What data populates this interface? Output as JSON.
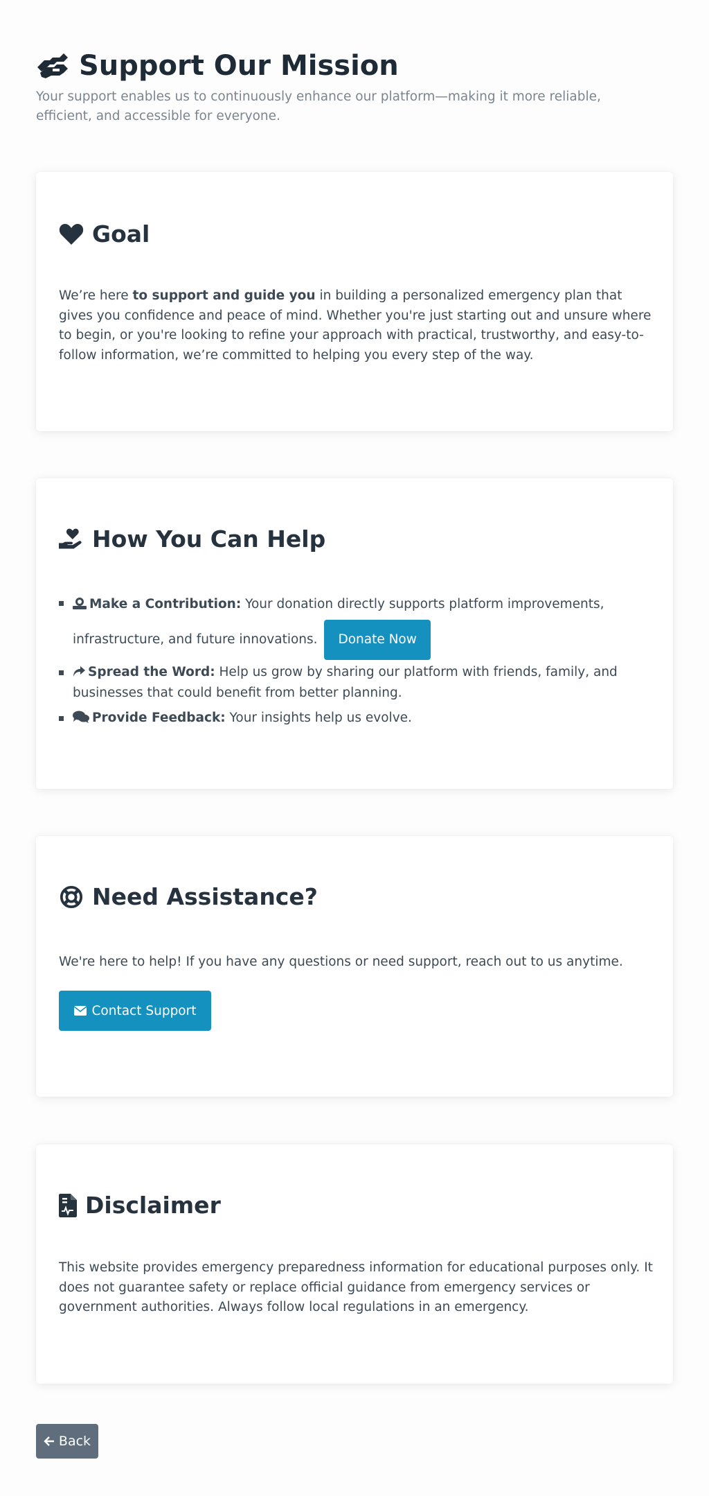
{
  "header": {
    "title": "Support Our Mission",
    "subtitle": "Your support enables us to continuously enhance our platform—making it more reliable, efficient, and accessible for everyone.",
    "icon": "handshake-icon"
  },
  "goal": {
    "title": "Goal",
    "icon": "heart-icon",
    "text_before": "We’re here ",
    "text_bold": "to support and guide you",
    "text_after": " in building a personalized emergency plan that gives you confidence and peace of mind. Whether you're just starting out and unsure where to begin, or you're looking to refine your approach with practical, trustworthy, and easy-to-follow information, we’re committed to helping you every step of the way."
  },
  "help": {
    "title": "How You Can Help",
    "icon": "hand-holding-heart-icon",
    "items": [
      {
        "label": "Make a Contribution:",
        "text_line1": " Your donation directly supports platform improvements,",
        "text_line2": "infrastructure, and future innovations.",
        "icon": "donate-icon",
        "button": "Donate Now"
      },
      {
        "label": "Spread the Word:",
        "text": " Help us grow by sharing our platform with friends, family, and businesses that could benefit from better planning.",
        "icon": "share-icon"
      },
      {
        "label": "Provide Feedback:",
        "text": " Your insights help us evolve.",
        "icon": "comments-icon"
      }
    ]
  },
  "assist": {
    "title": "Need Assistance?",
    "icon": "life-ring-icon",
    "text": "We're here to help! If you have any questions or need support, reach out to us anytime.",
    "button": "Contact Support",
    "button_icon": "envelope-icon"
  },
  "disclaimer": {
    "title": "Disclaimer",
    "icon": "file-medical-icon",
    "text": "This website provides emergency preparedness information for educational purposes only. It does not guarantee safety or replace official guidance from emergency services or government authorities. Always follow local regulations in an emergency."
  },
  "back": {
    "label": "Back",
    "icon": "arrow-left-icon"
  },
  "colors": {
    "accent": "#1591bf",
    "heading": "#1e2a36",
    "body_text": "#3d4a56",
    "muted": "#7b8590",
    "back_button": "#5f6d7c"
  }
}
